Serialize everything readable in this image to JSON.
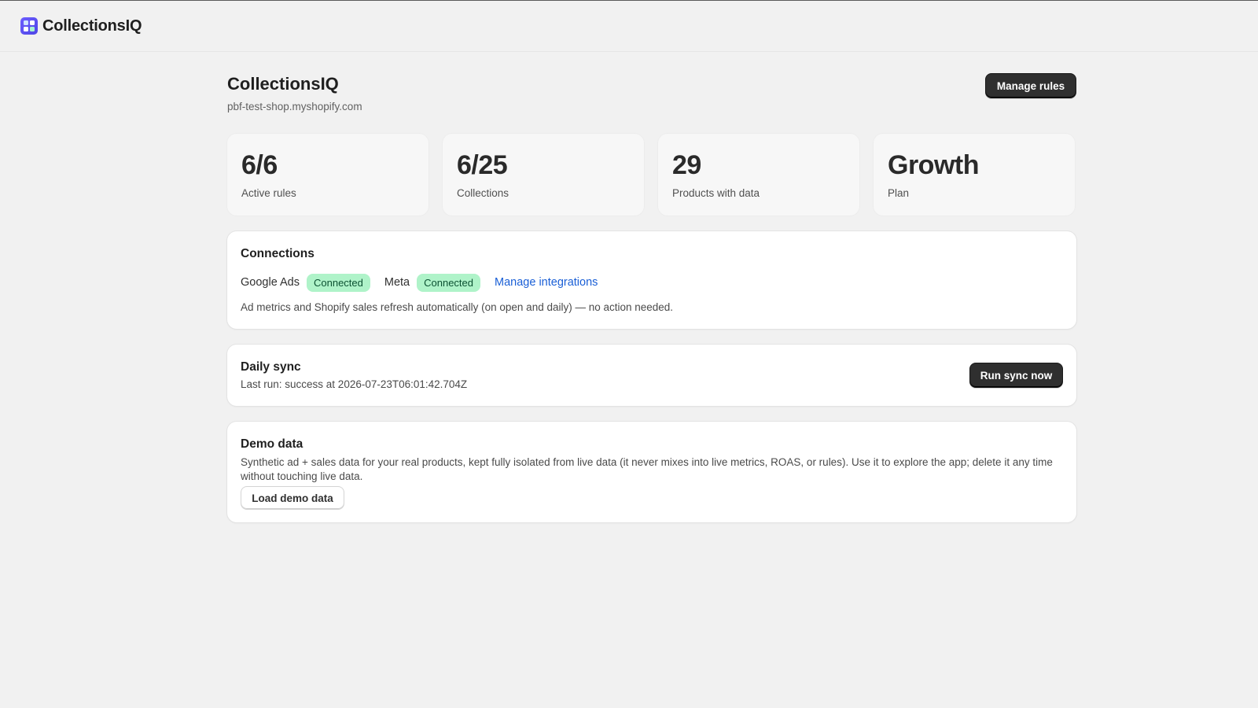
{
  "app": {
    "name": "CollectionsIQ",
    "logo_icon": "app-grid-logo-icon"
  },
  "header": {
    "title": "CollectionsIQ",
    "subtitle": "pbf-test-shop.myshopify.com",
    "manage_rules_label": "Manage rules"
  },
  "stats": [
    {
      "value": "6/6",
      "label": "Active rules"
    },
    {
      "value": "6/25",
      "label": "Collections"
    },
    {
      "value": "29",
      "label": "Products with data"
    },
    {
      "value": "Growth",
      "label": "Plan"
    }
  ],
  "connections": {
    "title": "Connections",
    "integrations": [
      {
        "name": "Google Ads",
        "status": "Connected"
      },
      {
        "name": "Meta",
        "status": "Connected"
      }
    ],
    "manage_link": "Manage integrations",
    "note": "Ad metrics and Shopify sales refresh automatically (on open and daily) — no action needed."
  },
  "sync": {
    "title": "Daily sync",
    "last_run": "Last run: success at 2026-07-23T06:01:42.704Z",
    "button_label": "Run sync now"
  },
  "demo": {
    "title": "Demo data",
    "description": "Synthetic ad + sales data for your real products, kept fully isolated from live data (it never mixes into live metrics, ROAS, or rules). Use it to explore the app; delete it any time without touching live data.",
    "button_label": "Load demo data"
  },
  "colors": {
    "badge_bg": "#aff3c9",
    "badge_text": "#0c5132",
    "link": "#1a5fd6",
    "primary_button": "#2f2f2f",
    "logo": "#5b50f0"
  }
}
